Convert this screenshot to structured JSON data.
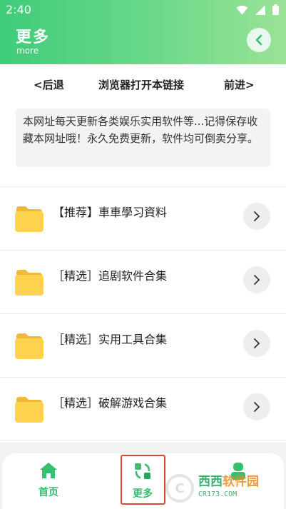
{
  "status_bar": {
    "time": "2:40"
  },
  "header": {
    "title": "更多",
    "subtitle": "more"
  },
  "nav": {
    "back_label": "<后退",
    "open_in_browser_label": "浏览器打开本链接",
    "forward_label": "前进>"
  },
  "notice": {
    "text": "本网址每天更新各类娱乐实用软件等...记得保存收藏本网址哦！永久免费更新，软件均可倒卖分享。"
  },
  "items": [
    {
      "label": "【推荐】車車學习資料"
    },
    {
      "label": "［精选］追剧软件合集"
    },
    {
      "label": "［精选］实用工具合集"
    },
    {
      "label": "［精选］破解游戏合集"
    }
  ],
  "tabbar": {
    "home_label": "首页",
    "more_label": "更多"
  },
  "watermark": {
    "brand_green": "西西",
    "brand_orange": "软件园",
    "domain": "CR173.COM"
  },
  "colors": {
    "accent": "#35c06f",
    "folder": "#ffd34e",
    "highlight_border": "#d9473b"
  },
  "icons": [
    "wifi-icon",
    "signal-icon",
    "battery-icon",
    "back-arrow-icon",
    "folder-icon",
    "chevron-right-icon",
    "home-icon",
    "refresh-icon",
    "user-icon"
  ]
}
